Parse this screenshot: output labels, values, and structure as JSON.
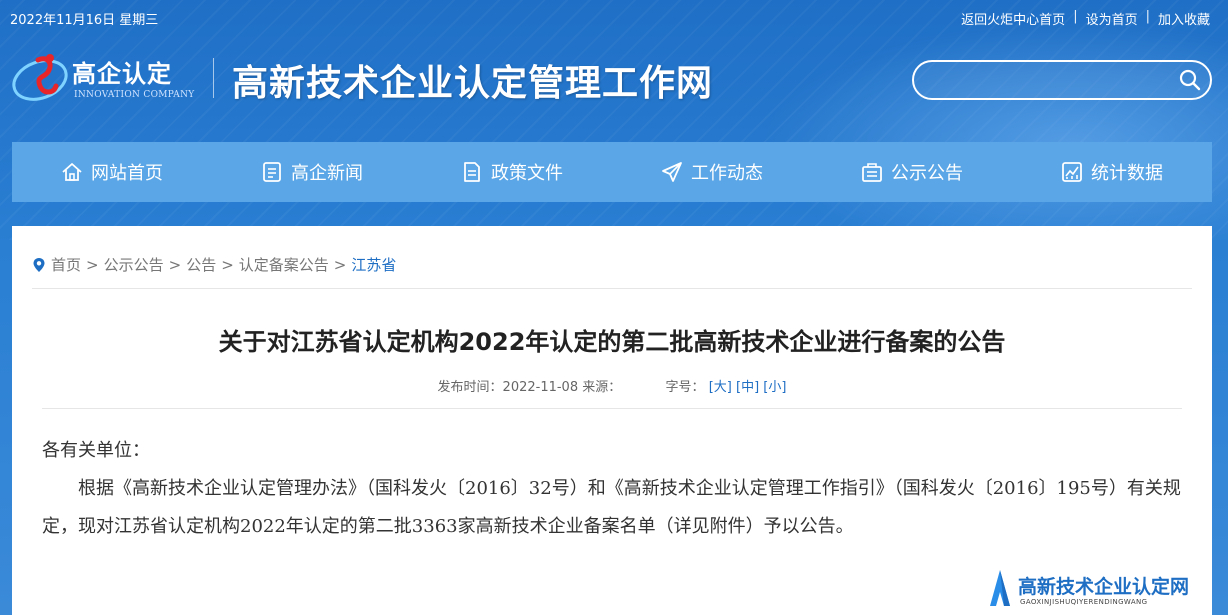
{
  "topbar": {
    "date": "2022年11月16日 星期三",
    "links": [
      "返回火炬中心首页",
      "设为首页",
      "加入收藏"
    ],
    "separator": "|"
  },
  "header": {
    "logo_cn": "高企认定",
    "logo_en": "INNOVATION COMPANY",
    "site_title": "高新技术企业认定管理工作网",
    "search_placeholder": ""
  },
  "nav": {
    "items": [
      {
        "label": "网站首页",
        "icon": "home-icon"
      },
      {
        "label": "高企新闻",
        "icon": "news-icon"
      },
      {
        "label": "政策文件",
        "icon": "document-icon"
      },
      {
        "label": "工作动态",
        "icon": "paper-plane-icon"
      },
      {
        "label": "公示公告",
        "icon": "announcement-icon"
      },
      {
        "label": "统计数据",
        "icon": "chart-icon"
      }
    ]
  },
  "breadcrumb": {
    "items": [
      "首页",
      "公示公告",
      "公告",
      "认定备案公告",
      "江苏省"
    ],
    "separator": ">"
  },
  "article": {
    "title": "关于对江苏省认定机构2022年认定的第二批高新技术企业进行备案的公告",
    "meta_publish_label": "发布时间：",
    "meta_publish_date": "2022-11-08",
    "meta_source_label": "来源：",
    "meta_font_label": "字号：",
    "font_sizes": [
      "[大]",
      "[中]",
      "[小]"
    ],
    "salutation": "各有关单位：",
    "paragraph": "根据《高新技术企业认定管理办法》（国科发火〔2016〕32号）和《高新技术企业认定管理工作指引》（国科发火〔2016〕195号）有关规定，现对江苏省认定机构2022年认定的第二批3363家高新技术企业备案名单（详见附件）予以公告。"
  },
  "watermark": {
    "title": "高新技术企业认定网",
    "subtitle": "GAOXINJISHUQIYERENDINGWANG"
  },
  "colors": {
    "nav_bg": "#5aa6e6",
    "accent": "#1e6ec4",
    "background": "#2a7fd3"
  }
}
